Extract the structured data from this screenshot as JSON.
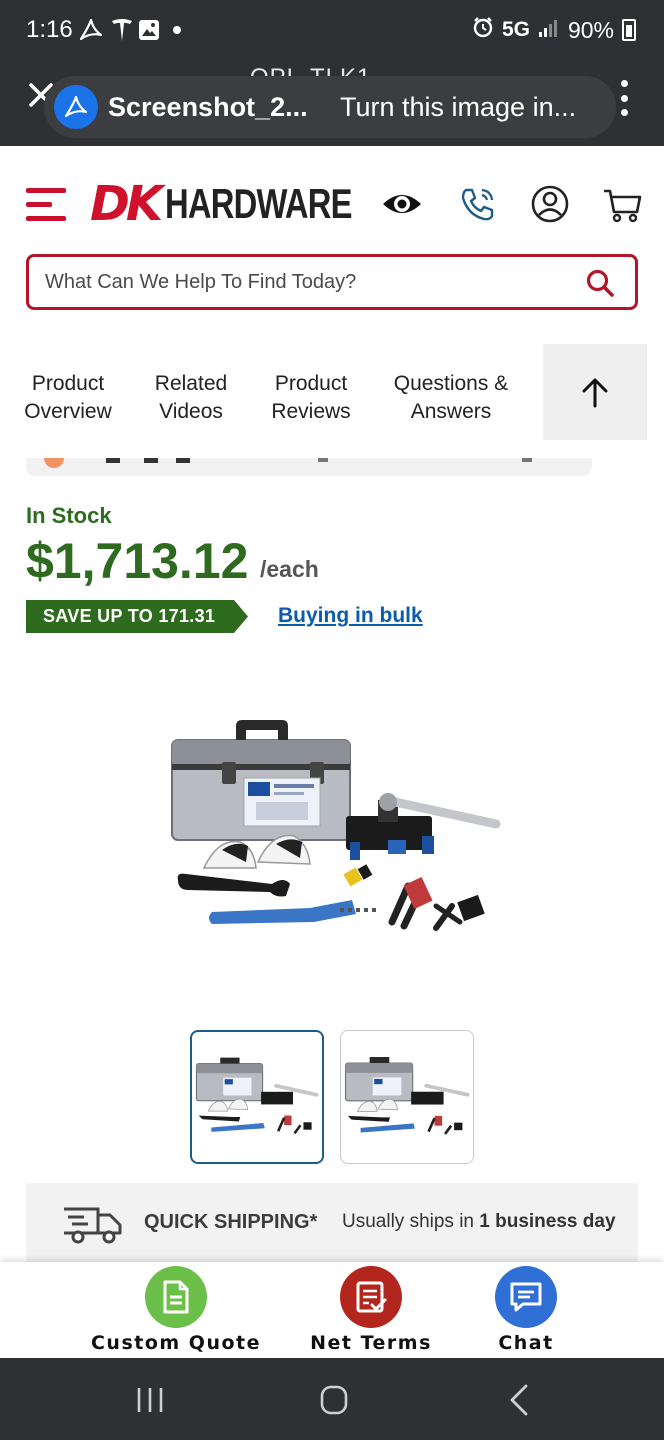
{
  "status_bar": {
    "time": "1:16",
    "network": "5G",
    "battery": "90%"
  },
  "viewer": {
    "behind_text": "OPL-TLK1",
    "filename": "Screenshot_2...",
    "prompt": "Turn this image in..."
  },
  "header": {
    "logo_mark": "DK",
    "logo_text": "HARDWARE",
    "search_placeholder": "What Can We Help To Find Today?"
  },
  "tabs": [
    {
      "line1": "Product",
      "line2": "Overview"
    },
    {
      "line1": "Related",
      "line2": "Videos"
    },
    {
      "line1": "Product",
      "line2": "Reviews"
    },
    {
      "line1": "Questions &",
      "line2": "Answers"
    }
  ],
  "product": {
    "stock_status": "In Stock",
    "price": "$1,713.12",
    "unit": "/each",
    "save_badge": "SAVE UP TO 171.31",
    "bulk_link": "Buying in bulk"
  },
  "shipping": {
    "label": "QUICK SHIPPING*",
    "text_prefix": "Usually ships in",
    "text_days": "1 business day"
  },
  "actions": [
    {
      "label": "Custom Quote",
      "color": "#6cc04a",
      "icon": "document-icon"
    },
    {
      "label": "Net Terms",
      "color": "#b3261e",
      "icon": "checklist-icon"
    },
    {
      "label": "Chat",
      "color": "#2f6fd6",
      "icon": "chat-icon"
    }
  ],
  "colors": {
    "brand_red": "#c8102e",
    "price_green": "#2e6b1f",
    "link_blue": "#0b5cad"
  }
}
